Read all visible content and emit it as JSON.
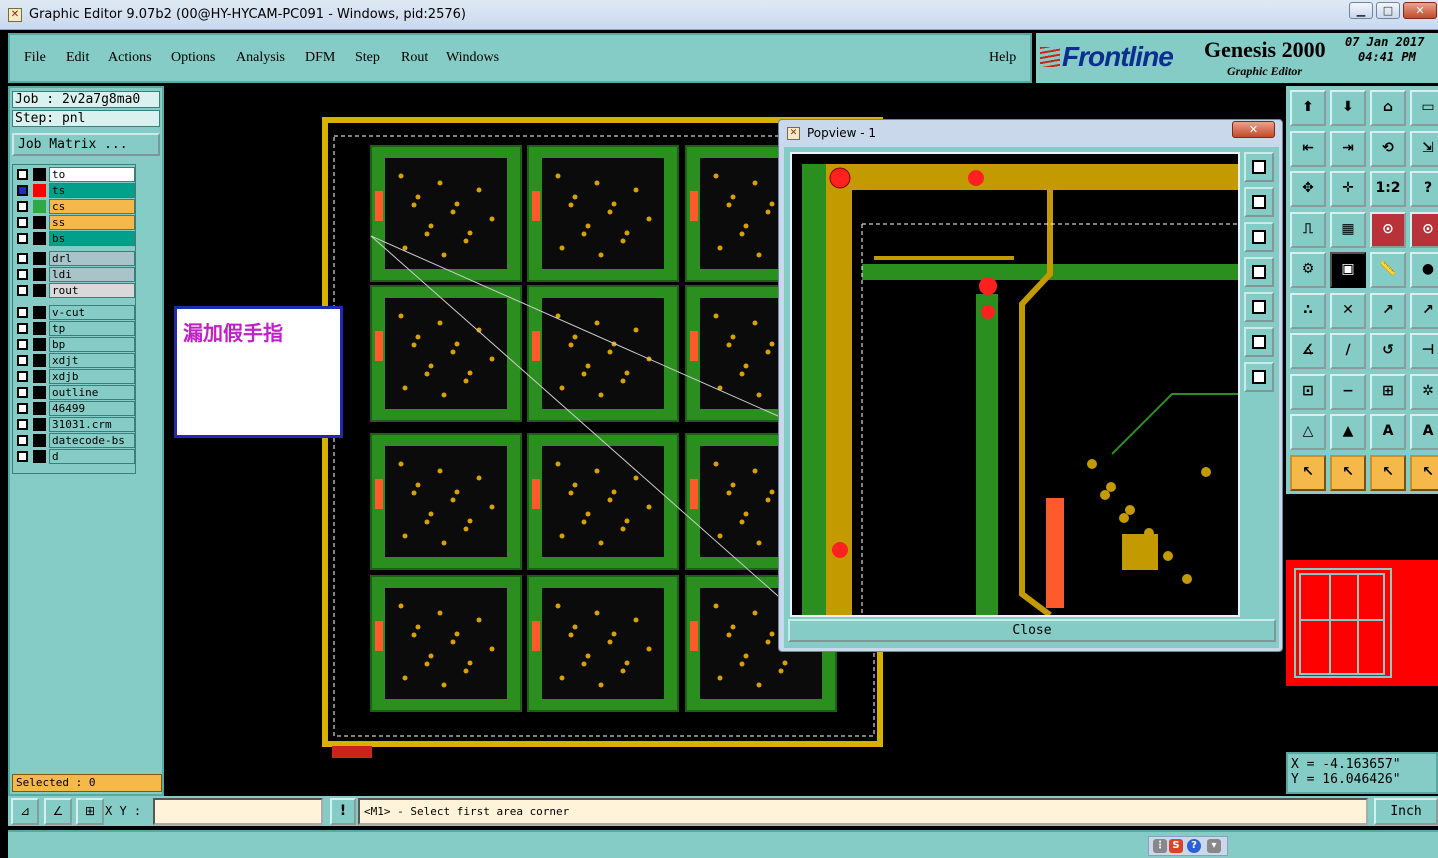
{
  "window": {
    "title": "Graphic Editor 9.07b2 (00@HY-HYCAM-PC091 - Windows, pid:2576)",
    "minimize": "▁",
    "maximize": "□",
    "close": "✕"
  },
  "menu": {
    "items": [
      "File",
      "Edit",
      "Actions",
      "Options",
      "Analysis",
      "DFM",
      "Step",
      "Rout",
      "Windows"
    ],
    "help": "Help"
  },
  "brand": {
    "logo": "Frontline",
    "product": "Genesis 2000",
    "subtitle": "Graphic Editor",
    "date": "07 Jan 2017",
    "time": "04:41 PM"
  },
  "left": {
    "job": "Job : 2v2a7g8ma0",
    "step": "Step: pnl",
    "job_matrix": "Job Matrix ...",
    "layers": [
      {
        "name": "to",
        "color": "#ffffff",
        "checked": false,
        "swatch": "#000000"
      },
      {
        "name": "ts",
        "color": "#00a08a",
        "checked": true,
        "swatch": "#ff0000"
      },
      {
        "name": "cs",
        "color": "#f5b84a",
        "checked": false,
        "swatch": "#2fa84a"
      },
      {
        "name": "ss",
        "color": "#f5b84a",
        "checked": false,
        "swatch": "#000000"
      },
      {
        "name": "bs",
        "color": "#00a08a",
        "checked": false,
        "swatch": "#000000"
      },
      {
        "name": "drl",
        "color": "#a9c4c8",
        "checked": false,
        "swatch": "#000000"
      },
      {
        "name": "ldi",
        "color": "#a9c4c8",
        "checked": false,
        "swatch": "#000000"
      },
      {
        "name": "rout",
        "color": "#d9d9d9",
        "checked": false,
        "swatch": "#000000"
      },
      {
        "name": "v-cut",
        "color": "#85cbc6",
        "checked": false,
        "swatch": "#000000"
      },
      {
        "name": "tp",
        "color": "#85cbc6",
        "checked": false,
        "swatch": "#000000"
      },
      {
        "name": "bp",
        "color": "#85cbc6",
        "checked": false,
        "swatch": "#000000"
      },
      {
        "name": "xdjt",
        "color": "#85cbc6",
        "checked": false,
        "swatch": "#000000"
      },
      {
        "name": "xdjb",
        "color": "#85cbc6",
        "checked": false,
        "swatch": "#000000"
      },
      {
        "name": "outline",
        "color": "#85cbc6",
        "checked": false,
        "swatch": "#000000"
      },
      {
        "name": "46499",
        "color": "#85cbc6",
        "checked": false,
        "swatch": "#000000"
      },
      {
        "name": "31031.crm",
        "color": "#85cbc6",
        "checked": false,
        "swatch": "#000000"
      },
      {
        "name": "datecode-bs",
        "color": "#85cbc6",
        "checked": false,
        "swatch": "#000000"
      },
      {
        "name": "d",
        "color": "#85cbc6",
        "checked": false,
        "swatch": "#000000"
      }
    ],
    "selected": "Selected : 0"
  },
  "note": {
    "text": "漏加假手指"
  },
  "popview": {
    "title": "Popview - 1",
    "close_label": "Close"
  },
  "coords": {
    "x": "X = -4.163657\"",
    "y": "Y = 16.046426\""
  },
  "bottom": {
    "xy_label": "X Y :",
    "xy_value": "",
    "prompt": "<M1> - Select first area corner",
    "units": "Inch",
    "bang": "!"
  },
  "tray": {
    "s_icon": "S",
    "help_icon": "?"
  }
}
